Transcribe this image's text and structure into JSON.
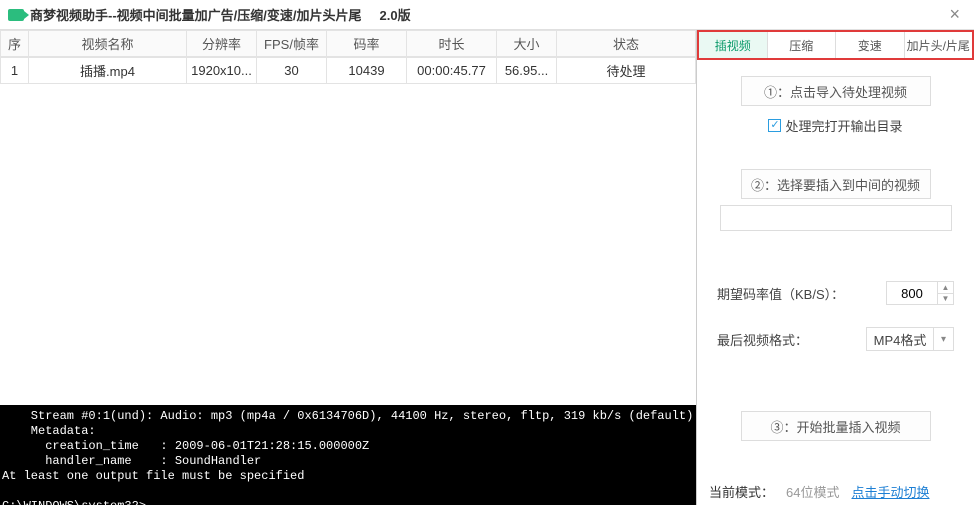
{
  "title_bar": {
    "title": "商梦视频助手--视频中间批量加广告/压缩/变速/加片头片尾",
    "version": "2.0版",
    "close_glyph": "×"
  },
  "table": {
    "headers": {
      "idx": "序",
      "name": "视频名称",
      "res": "分辨率",
      "fps": "FPS/帧率",
      "br": "码率",
      "dur": "时长",
      "size": "大小",
      "state": "状态"
    },
    "rows": [
      {
        "idx": "1",
        "name": "插播.mp4",
        "res": "1920x10...",
        "fps": "30",
        "br": "10439",
        "dur": "00:00:45.77",
        "size": "56.95...",
        "state": "待处理"
      }
    ]
  },
  "terminal": {
    "text": "    Stream #0:1(und): Audio: mp3 (mp4a / 0x6134706D), 44100 Hz, stereo, fltp, 319 kb/s (default)\n    Metadata:\n      creation_time   : 2009-06-01T21:28:15.000000Z\n      handler_name    : SoundHandler\nAt least one output file must be specified\n\nC:\\WINDOWS\\system32>"
  },
  "side": {
    "tabs": [
      "插视频",
      "压缩",
      "变速",
      "加片头/片尾"
    ],
    "active_tab": 0,
    "step1": "①：点击导入待处理视频",
    "checkbox_label": "处理完打开输出目录",
    "step2": "②：选择要插入到中间的视频",
    "bitrate": {
      "label": "期望码率值（KB/S）：",
      "value": "800"
    },
    "format": {
      "label": "最后视频格式：",
      "value": "MP4格式"
    },
    "step3": "③：开始批量插入视频"
  },
  "footer": {
    "mode_label": "当前模式：",
    "mode_value": "64位模式",
    "link": "点击手动切换"
  }
}
